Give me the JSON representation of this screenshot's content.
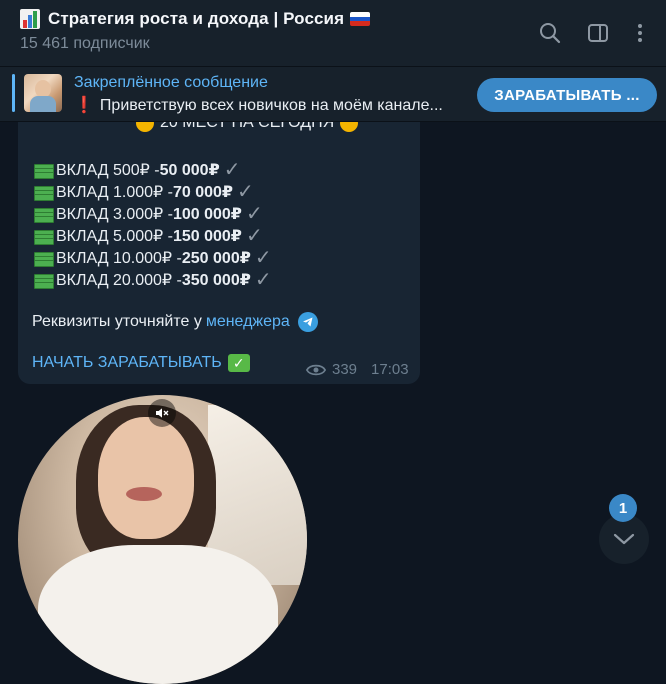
{
  "header": {
    "title": "Стратегия роста и дохода | Россия",
    "subscribers": "15 461 подписчик",
    "icons": [
      "chart-emoji",
      "russia-flag",
      "search-icon",
      "sidebar-toggle-icon",
      "more-vertical-icon"
    ]
  },
  "pinned": {
    "title": "Закреплённое сообщение",
    "text": "Приветствую всех новичков на моём канале...",
    "exclamation": "❗",
    "button_label": "ЗАРАБАТЫВАТЬ ..."
  },
  "message": {
    "top_partial": "20 МЕСТ НА СЕГОДНЯ",
    "deposits": [
      {
        "label": "ВКЛАД 500₽ - ",
        "amount": "50 000₽"
      },
      {
        "label": "ВКЛАД 1.000₽ - ",
        "amount": "70 000₽"
      },
      {
        "label": "ВКЛАД 3.000₽ - ",
        "amount": "100 000₽"
      },
      {
        "label": "ВКЛАД 5.000₽ - ",
        "amount": "150 000₽"
      },
      {
        "label": "ВКЛАД 10.000₽ - ",
        "amount": "250 000₽"
      },
      {
        "label": "ВКЛАД 20.000₽ - ",
        "amount": "350 000₽"
      }
    ],
    "requisites_text": "Реквизиты уточняйте у",
    "manager_link": "менеджера",
    "start_link": "НАЧАТЬ ЗАРАБАТЫВАТЬ",
    "views": "339",
    "time": "17:03"
  },
  "scroll": {
    "unread_count": "1"
  },
  "colors": {
    "background": "#0e1621",
    "panel": "#17212b",
    "bubble": "#182533",
    "accent": "#5eb5f7",
    "button": "#3a88c7"
  }
}
